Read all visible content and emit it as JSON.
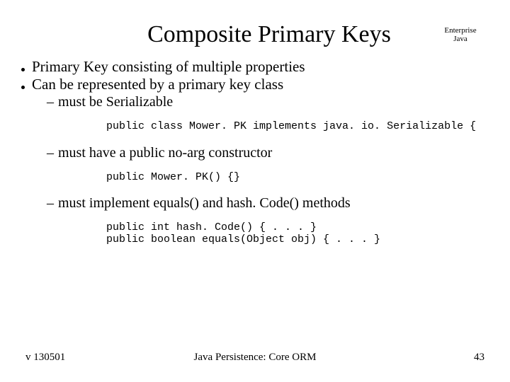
{
  "header": {
    "title": "Composite Primary Keys",
    "corner": "Enterprise\nJava"
  },
  "bullets": {
    "item1": "Primary Key consisting of multiple properties",
    "item2": "Can be represented by a primary key class",
    "sub1": "must be Serializable",
    "code1": "public class Mower. PK implements java. io. Serializable {",
    "sub2": "must have a public no-arg constructor",
    "code2": "public Mower. PK() {}",
    "sub3": "must implement equals() and hash. Code() methods",
    "code3": "public int hash. Code() { . . . }\npublic boolean equals(Object obj) { . . . }"
  },
  "footer": {
    "version": "v 130501",
    "center": "Java Persistence: Core ORM",
    "page": "43"
  }
}
